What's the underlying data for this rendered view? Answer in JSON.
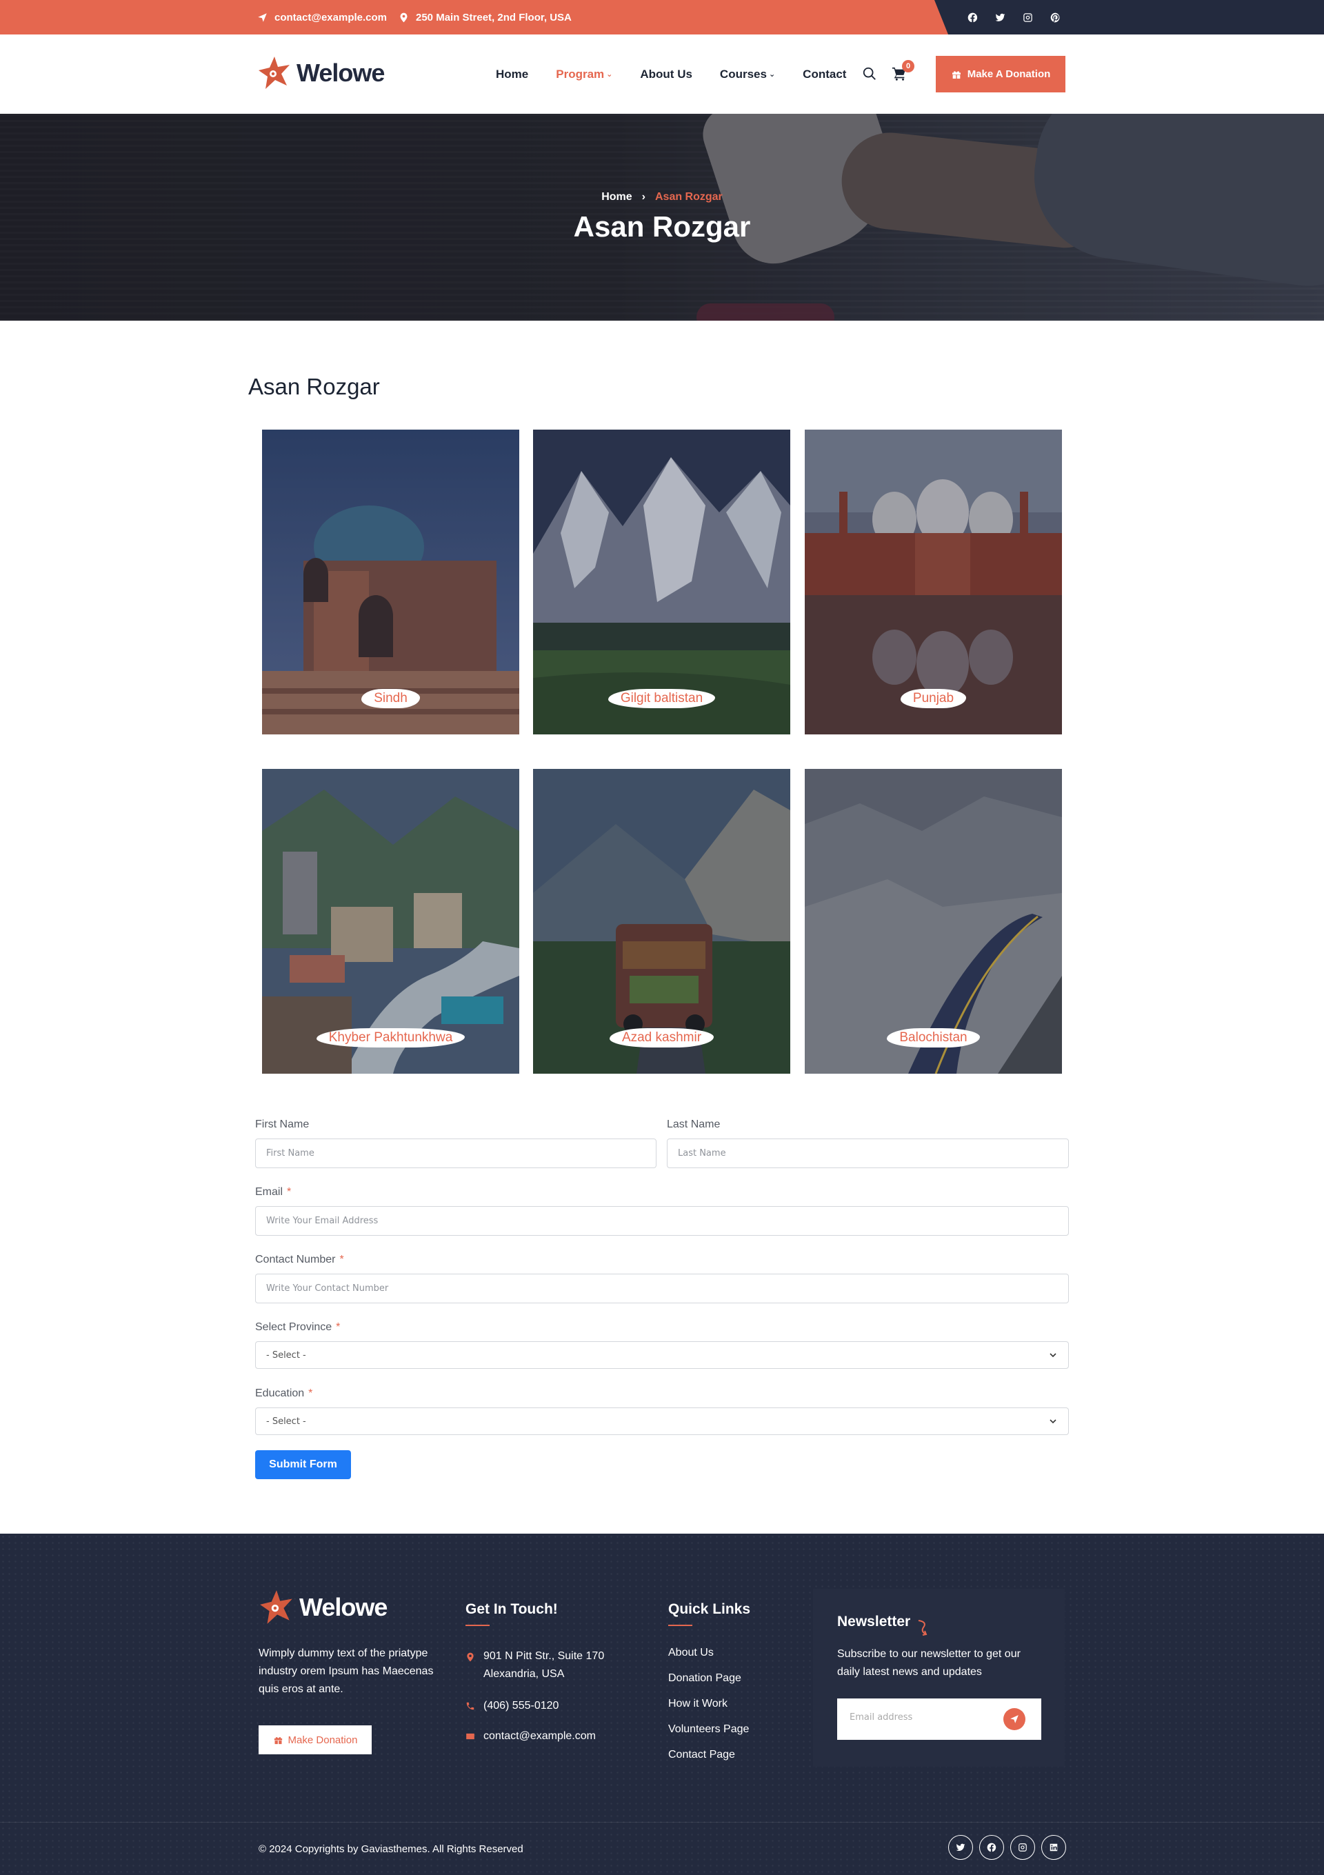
{
  "topbar": {
    "email": "contact@example.com",
    "address": "250 Main Street, 2nd Floor, USA",
    "social_icons": [
      "facebook-icon",
      "twitter-icon",
      "instagram-icon",
      "pinterest-icon"
    ]
  },
  "header": {
    "logo_text": "Welowe",
    "nav": [
      {
        "label": "Home",
        "has_dropdown": false,
        "active": false
      },
      {
        "label": "Program",
        "has_dropdown": true,
        "active": true
      },
      {
        "label": "About Us",
        "has_dropdown": false,
        "active": false
      },
      {
        "label": "Courses",
        "has_dropdown": true,
        "active": false
      },
      {
        "label": "Contact",
        "has_dropdown": false,
        "active": false
      }
    ],
    "cart_count": "0",
    "donate_label": "Make A Donation"
  },
  "hero": {
    "breadcrumb_home": "Home",
    "breadcrumb_sep": "›",
    "breadcrumb_current": "Asan Rozgar",
    "title": "Asan Rozgar"
  },
  "section": {
    "title": "Asan Rozgar",
    "cards": [
      {
        "label": "Sindh"
      },
      {
        "label": "Gilgit baltistan"
      },
      {
        "label": "Punjab"
      },
      {
        "label": "Khyber Pakhtunkhwa"
      },
      {
        "label": "Azad kashmir"
      },
      {
        "label": "Balochistan"
      }
    ]
  },
  "form": {
    "first_name_label": "First Name",
    "first_name_placeholder": "First Name",
    "last_name_label": "Last Name",
    "last_name_placeholder": "Last Name",
    "email_label": "Email",
    "email_placeholder": "Write Your Email Address",
    "contact_label": "Contact Number",
    "contact_placeholder": "Write Your Contact Number",
    "province_label": "Select Province",
    "province_value": "- Select -",
    "education_label": "Education",
    "education_value": "- Select -",
    "required_mark": "*",
    "submit_label": "Submit Form"
  },
  "footer": {
    "logo_text": "Welowe",
    "about": "Wimply dummy text of the priatype industry orem Ipsum has Maecenas quis eros at ante.",
    "donate_label": "Make Donation",
    "contact_heading": "Get In Touch!",
    "address_line1": "901 N Pitt Str., Suite 170",
    "address_line2": "Alexandria, USA",
    "phone": "(406) 555-0120",
    "email": "contact@example.com",
    "links_heading": "Quick Links",
    "links": [
      "About Us",
      "Donation Page",
      "How it Work",
      "Volunteers Page",
      "Contact Page"
    ],
    "newsletter_heading": "Newsletter",
    "newsletter_text": "Subscribe to our newsletter to get our daily latest news and updates",
    "newsletter_placeholder": "Email address",
    "copyright": "© 2024 Copyrights by Gaviasthemes. All Rights Reserved",
    "social_icons": [
      "twitter-icon",
      "facebook-icon",
      "instagram-icon",
      "linkedin-icon"
    ]
  },
  "colors": {
    "accent": "#e5674f",
    "dark": "#232a3e",
    "submit": "#1f7bf6"
  }
}
